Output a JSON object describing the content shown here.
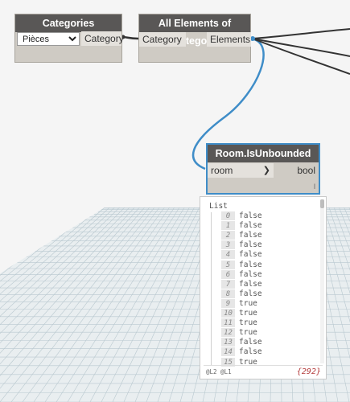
{
  "nodes": {
    "categories": {
      "title": "Categories",
      "dropdown_value": "Pièces",
      "output_port": "Category"
    },
    "all_elements": {
      "title": "All Elements of Category",
      "input_port": "Category",
      "output_port": "Elements"
    },
    "room_unbounded": {
      "title": "Room.IsUnbounded",
      "input_port": "room",
      "output_port": "bool",
      "lacing_marker": "l"
    }
  },
  "watch": {
    "header": "List",
    "items": [
      {
        "index": "0",
        "value": "false"
      },
      {
        "index": "1",
        "value": "false"
      },
      {
        "index": "2",
        "value": "false"
      },
      {
        "index": "3",
        "value": "false"
      },
      {
        "index": "4",
        "value": "false"
      },
      {
        "index": "5",
        "value": "false"
      },
      {
        "index": "6",
        "value": "false"
      },
      {
        "index": "7",
        "value": "false"
      },
      {
        "index": "8",
        "value": "false"
      },
      {
        "index": "9",
        "value": "true"
      },
      {
        "index": "10",
        "value": "true"
      },
      {
        "index": "11",
        "value": "true"
      },
      {
        "index": "12",
        "value": "true"
      },
      {
        "index": "13",
        "value": "false"
      },
      {
        "index": "14",
        "value": "false"
      },
      {
        "index": "15",
        "value": "true"
      }
    ],
    "levels": "@L2 @L1",
    "count": "{292}"
  },
  "colors": {
    "wire_blue": "#3f8dc8",
    "wire_dark": "#333333",
    "node_header": "#595756",
    "node_body": "#cfcbc4",
    "count_red": "#b33b3b"
  }
}
